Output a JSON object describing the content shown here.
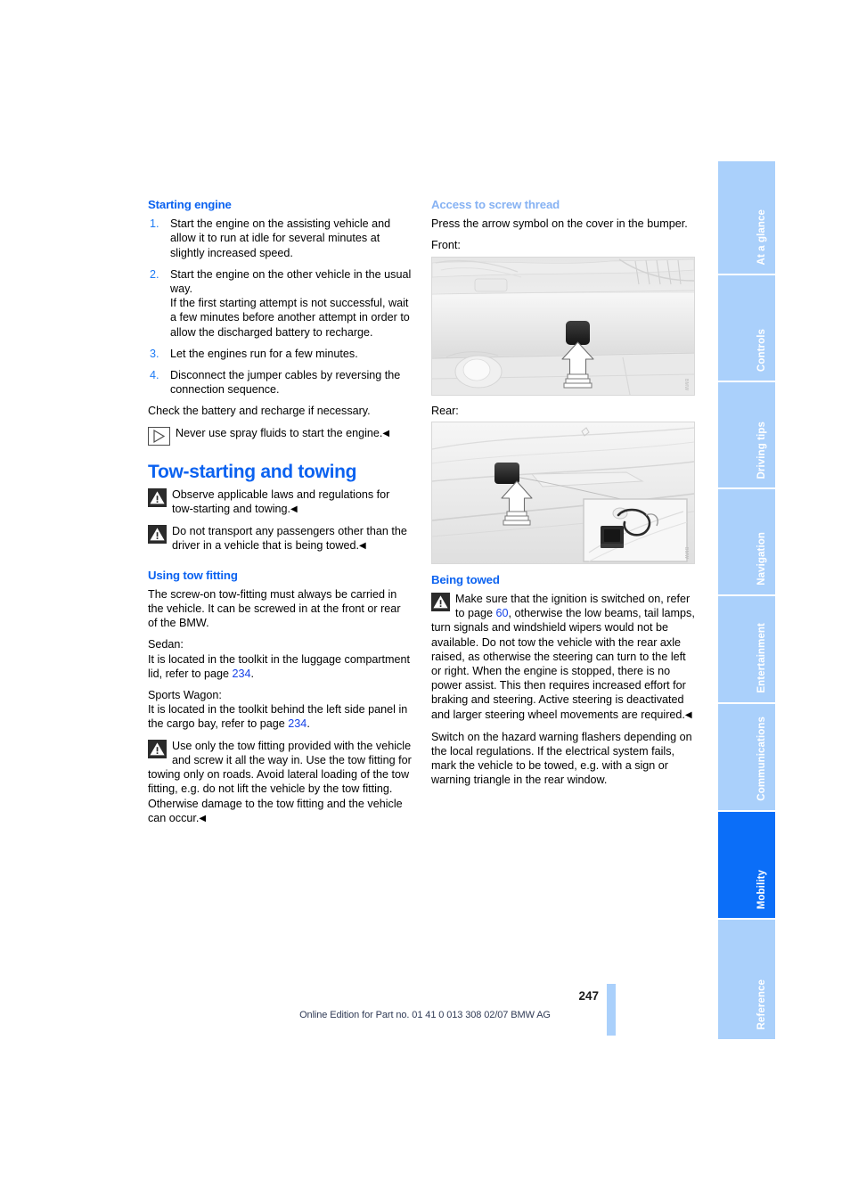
{
  "document": {
    "page_number": "247",
    "footer_note": "Online Edition for Part no. 01 41 0 013 308 02/07 BMW AG"
  },
  "left_column": {
    "starting_engine": {
      "heading": "Starting engine",
      "steps": [
        {
          "num": "1.",
          "text": "Start the engine on the assisting vehicle and allow it to run at idle for several minutes at slightly increased speed."
        },
        {
          "num": "2.",
          "text": "Start the engine on the other vehicle in the usual way.\nIf the first starting attempt is not successful, wait a few minutes before another attempt in order to allow the discharged battery to recharge."
        },
        {
          "num": "3.",
          "text": "Let the engines run for a few minutes."
        },
        {
          "num": "4.",
          "text": "Disconnect the jumper cables by reversing the connection sequence."
        }
      ],
      "closing": "Check the battery and recharge if necessary.",
      "note": "Never use spray fluids to start the engine."
    },
    "tow_starting": {
      "chapter_heading": "Tow-starting and towing",
      "warning_1": "Observe applicable laws and regulations for tow-starting and towing.",
      "warning_2": "Do not transport any passengers other than the driver in a vehicle that is being towed."
    },
    "using_tow_fitting": {
      "heading": "Using tow fitting",
      "intro": "The screw-on tow-fitting must always be carried in the vehicle. It can be screwed in at the front or rear of the BMW.",
      "sedan_label": "Sedan:",
      "sedan_text_before": "It is located in the toolkit in the luggage compartment lid, refer to page ",
      "sedan_page_ref": "234",
      "sedan_text_after": ".",
      "wagon_label": "Sports Wagon:",
      "wagon_text_before": "It is located in the toolkit behind the left side panel in the cargo bay, refer to page ",
      "wagon_page_ref": "234",
      "wagon_text_after": ".",
      "warning": "Use only the tow fitting provided with the vehicle and screw it all the way in. Use the tow fitting for towing only on roads. Avoid lateral loading of the tow fitting, e.g. do not lift the vehicle by the tow fitting. Otherwise damage to the tow fitting and the vehicle can occur."
    }
  },
  "right_column": {
    "access_screw_thread": {
      "heading": "Access to screw thread",
      "intro": "Press the arrow symbol on the cover in the bumper.",
      "front_label": "Front:",
      "rear_label": "Rear:"
    },
    "figures": [
      {
        "name": "front-bumper-cover-figure",
        "caption": "Front bumper cover with arrow symbol",
        "watermark": "BMW"
      },
      {
        "name": "rear-bumper-cover-figure",
        "caption": "Rear bumper cover with arrow symbol and tow-fitting cap detail",
        "watermark": "BMW"
      }
    ],
    "being_towed": {
      "heading": "Being towed",
      "warning_before": "Make sure that the ignition is switched on, refer to page ",
      "warning_page_ref": "60",
      "warning_after": ", otherwise the low beams, tail lamps, turn signals and windshield wipers would not be available. Do not tow the vehicle with the rear axle raised, as otherwise the steering can turn to the left or right. When the engine is stopped, there is no power assist. This then requires increased effort for braking and steering. Active steering is deactivated and larger steering wheel movements are required.",
      "paragraph": "Switch on the hazard warning flashers depending on the local regulations. If the electrical system fails, mark the vehicle to be towed, e.g. with a sign or warning triangle in the rear window."
    }
  },
  "sidebar": {
    "tabs": [
      {
        "label": "At a glance",
        "active": false
      },
      {
        "label": "Controls",
        "active": false
      },
      {
        "label": "Driving tips",
        "active": false
      },
      {
        "label": "Navigation",
        "active": false
      },
      {
        "label": "Entertainment",
        "active": false
      },
      {
        "label": "Communications",
        "active": false
      },
      {
        "label": "Mobility",
        "active": true
      },
      {
        "label": "Reference",
        "active": false
      }
    ]
  },
  "colors": {
    "heading_blue": "#0b62f0",
    "heading_blue_pale": "#86b2f3",
    "tab_inactive": "#aad0fb",
    "tab_active": "#0b6ef8",
    "page_ref": "#1442e8"
  }
}
